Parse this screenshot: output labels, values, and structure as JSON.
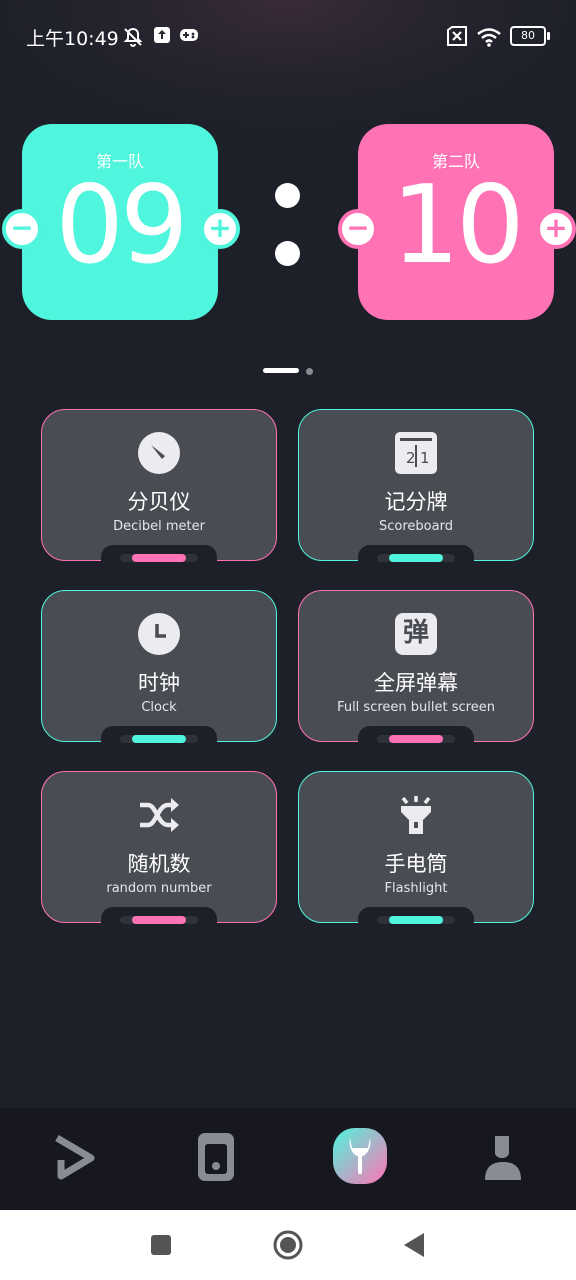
{
  "status_bar": {
    "time": "上午10:49",
    "battery": "80"
  },
  "scoreboard": {
    "team1": {
      "name": "第一队",
      "score": "09",
      "color": "#4ff5dc"
    },
    "team2": {
      "name": "第二队",
      "score": "10",
      "color": "#ff73b5"
    },
    "minus": "−",
    "plus": "+"
  },
  "tools": [
    {
      "title_zh": "分贝仪",
      "title_en": "Decibel meter",
      "icon": "gauge-icon",
      "accent": "#ff73b5"
    },
    {
      "title_zh": "记分牌",
      "title_en": "Scoreboard",
      "icon": "scoreboard-icon",
      "accent": "#4ff5dc"
    },
    {
      "title_zh": "时钟",
      "title_en": "Clock",
      "icon": "clock-icon",
      "accent": "#4ff5dc"
    },
    {
      "title_zh": "全屏弹幕",
      "title_en": "Full screen bullet screen",
      "icon": "bullet-screen-icon",
      "accent": "#ff73b5",
      "icon_char": "弹"
    },
    {
      "title_zh": "随机数",
      "title_en": "random number",
      "icon": "shuffle-icon",
      "accent": "#ff73b5"
    },
    {
      "title_zh": "手电筒",
      "title_en": "Flashlight",
      "icon": "flashlight-icon",
      "accent": "#4ff5dc"
    }
  ],
  "scoreboard_icon_digits": {
    "left": "2",
    "right": "1"
  },
  "bottom_nav": [
    {
      "icon": "play-icon"
    },
    {
      "icon": "device-icon"
    },
    {
      "icon": "toolbox-icon",
      "active": true
    },
    {
      "icon": "profile-icon"
    }
  ]
}
